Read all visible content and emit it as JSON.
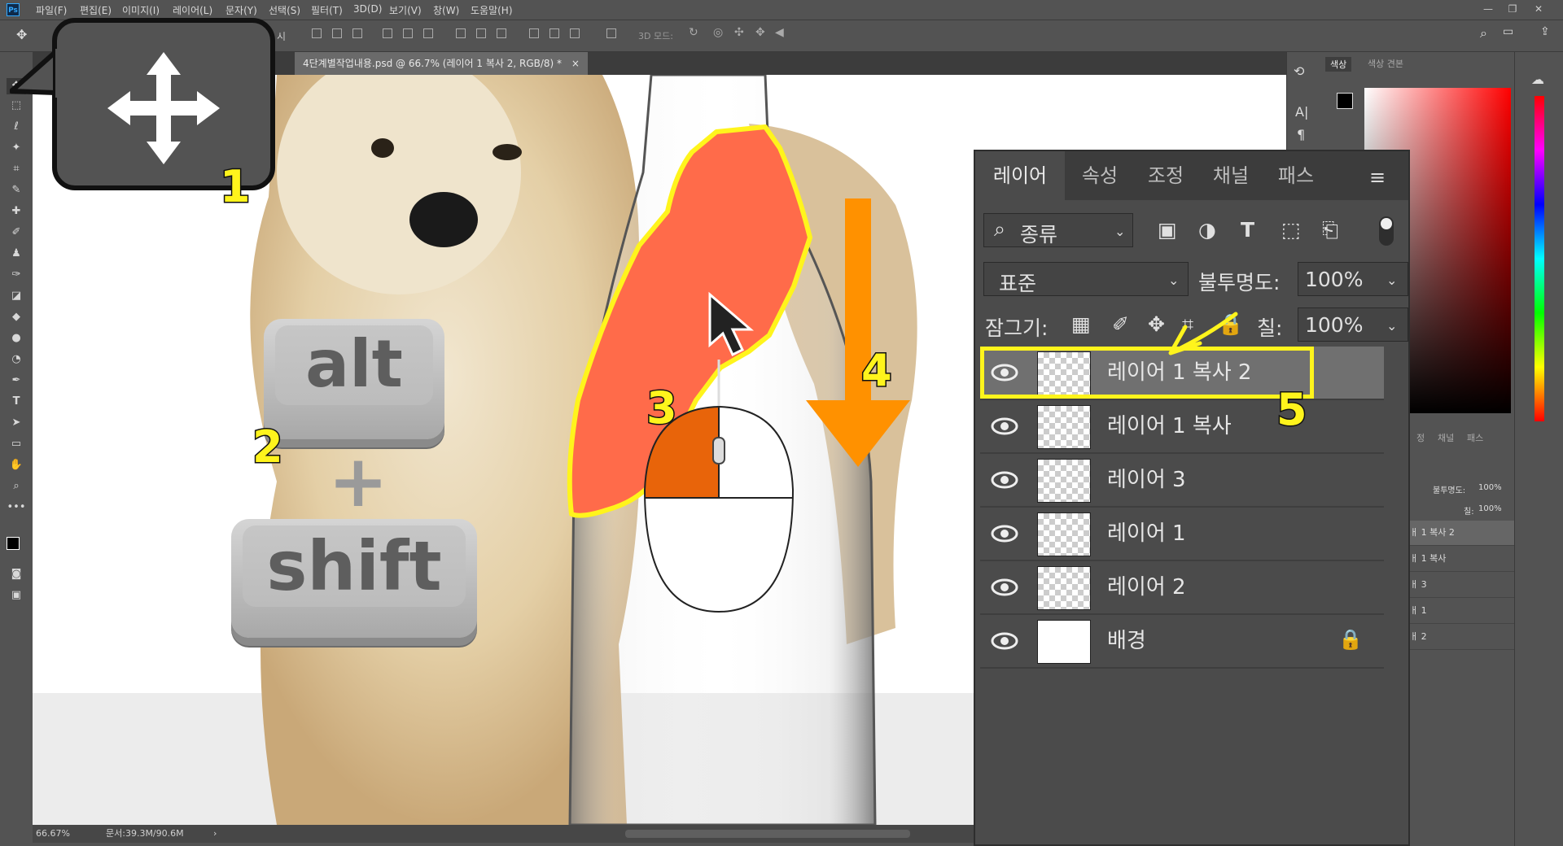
{
  "app": {
    "logo": "Ps"
  },
  "menu": [
    "파일(F)",
    "편집(E)",
    "이미지(I)",
    "레이어(L)",
    "문자(Y)",
    "선택(S)",
    "필터(T)",
    "3D(D)",
    "보기(V)",
    "창(W)",
    "도움말(H)"
  ],
  "window_controls": {
    "minimize": "—",
    "restore": "❐",
    "close": "✕"
  },
  "options_bar": {
    "partial_label": "시",
    "mode_3d": "3D 모드:"
  },
  "document_tab": {
    "title": "4단계별작업내용.psd @ 66.7% (레이어 1 복사 2, RGB/8) *",
    "close": "×"
  },
  "status_bar": {
    "zoom": "66.67%",
    "doc_info": "문서:39.3M/90.6M",
    "arrow": "›"
  },
  "color_panel": {
    "tabs": [
      "색상",
      "색상 견본"
    ]
  },
  "layers_panel": {
    "tabs": [
      "레이어",
      "속성",
      "조정",
      "채널",
      "패스"
    ],
    "filter_label": "종류",
    "blend_mode": "표준",
    "opacity_label": "불투명도:",
    "opacity_value": "100%",
    "lock_label": "잠그기:",
    "fill_label": "칠:",
    "fill_value": "100%",
    "layers": [
      {
        "name": "레이어 1 복사 2",
        "selected": true
      },
      {
        "name": "레이어 1 복사",
        "selected": false
      },
      {
        "name": "레이어 3",
        "selected": false
      },
      {
        "name": "레이어 1",
        "selected": false
      },
      {
        "name": "레이어 2",
        "selected": false
      },
      {
        "name": "배경",
        "selected": false,
        "locked": true
      }
    ]
  },
  "mini_layers_panel": {
    "tabs": [
      "정",
      "채널",
      "패스"
    ],
    "opacity_label": "불투명도:",
    "opacity_value": "100%",
    "fill_label": "칠:",
    "fill_value": "100%",
    "rows": [
      "ㅐ 1 복사 2",
      "ㅐ 1 복사",
      "ㅐ 3",
      "ㅐ 1",
      "ㅐ 2"
    ]
  },
  "annotations": {
    "step1": "1",
    "step2": "2",
    "step3": "3",
    "step4": "4",
    "step5": "5",
    "key_alt": "alt",
    "key_plus": "+",
    "key_shift": "shift"
  },
  "colors": {
    "highlight_yellow": "#fff41c",
    "selection_fill": "#ff6b4a",
    "arrow_orange": "#ff9100",
    "mouse_orange": "#e8640a"
  }
}
